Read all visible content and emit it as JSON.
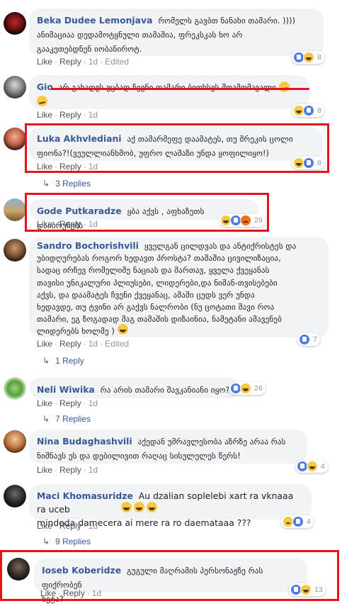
{
  "action_labels": {
    "like": "Like",
    "reply": "Reply",
    "edited": "Edited"
  },
  "comments": [
    {
      "name": "Beka Dudee Lemonjava",
      "text_lines": [
        "რომელს გავბთ ნანახი თამარი. ))))",
        "ანიმაციაა დედამოტყნული თამაშია, ფრეკსკას ხო არ",
        "გააკეთებდნენ იობანიროტ."
      ],
      "time": "1d",
      "edited": true,
      "reaction_count": "8"
    },
    {
      "name": "Gio",
      "text_lines": [
        "არ გახადეს უცბად ჩვენი თამარი ბიოხსეს შთამომავალი",
        ""
      ],
      "time": "1d",
      "edited": false,
      "reaction_count": "8"
    },
    {
      "name": "Luka Akhvlediani",
      "text_lines": [
        "აქ თამარმეფე დაამატეს, თუ შრეკის ცოლი",
        "ფიონა?!(ვეულლიანხმობ, უფრო ლამაზი უნდა ყოფილიყო!)"
      ],
      "time": "1d",
      "edited": false,
      "reaction_count": "8",
      "replies": "3 Replies"
    },
    {
      "name": "Gode Putkaradze",
      "text_lines": [
        "ყბა აქვს , აფხაზეთს დაიბრუნებს"
      ],
      "time": "1d",
      "edited": false,
      "reaction_count": "29"
    },
    {
      "name": "Sandro Bochorishvili",
      "text_lines": [
        "ყველგან ცილდვას და ანტიქრისტეს და",
        "უბიდღურებას როგორ ხედავთ პროსტა? თამაშია ცივილიზაცია,",
        "სადაც ირჩევ რომელიმე ნაციას და მართავ, ყველა ქვეყანას",
        "თავისი უნიკალური პლიუსები, ლიდერები,და ნიშან-თვისებები",
        "აქვს, და დაამატეს ჩვენი ქვეყანაც, ამაში ცუდს ვერ უნდა",
        "ხედავდე, თუ ტვინი არ გაქვს ნალრობი (ნუ ცოტათი შავი როა",
        "თამარი, ეგ ზოგადად მაგ თამაშის დიზაინია, ნამეტანი ამავენებ",
        "ლიდერებს ხოლმე  )"
      ],
      "time": "1d",
      "edited": true,
      "reaction_count": "7",
      "replies": "1 Reply"
    },
    {
      "name": "Neli Wiwika",
      "text_lines": [
        "რა არის თამარი შავკანიანი იყო?"
      ],
      "time": "1d",
      "edited": false,
      "reaction_count": "26",
      "replies": "7 Replies"
    },
    {
      "name": "Nina Budaghashvili",
      "text_lines": [
        "აქედან უმრავლესობა აზრზე არაა რას",
        "ნიშნავს ეს და დებილივით რაღაც სისულელეს წერს!"
      ],
      "time": "1d",
      "edited": false,
      "reaction_count": "4"
    },
    {
      "name": "Maci Khomasuridze",
      "text_lines": [
        "Au dzalian soplelebi xart ra vknaaa ra uceb",
        "mindoda damecera  ai mere ra ro daemataaa ???"
      ],
      "time": "1d",
      "edited": false,
      "reaction_count": "4",
      "replies": "9 Replies"
    },
    {
      "name": "Ioseb Koberidze",
      "text_lines": [
        "გუგული მაღრამის პერსონაჟზე რას ფიქრობენ",
        "ნეტა?"
      ],
      "time": "1d",
      "edited": false,
      "reaction_count": "13"
    }
  ],
  "colors": {
    "name": "#385898",
    "bubble": "#f2f3f5",
    "highlight": "#e8121f",
    "meta": "#90949c"
  }
}
